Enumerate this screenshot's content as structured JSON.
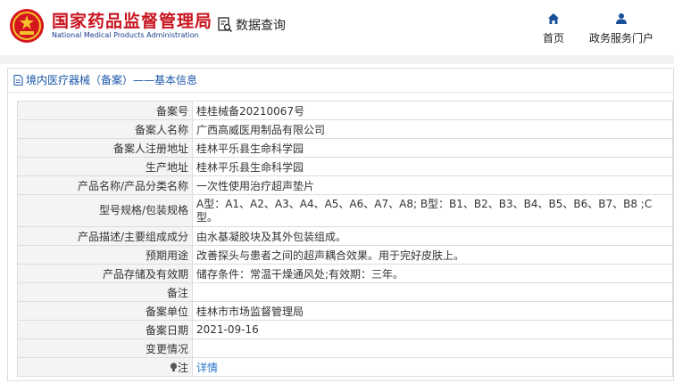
{
  "header": {
    "brand_cn": "国家药品监督管理局",
    "brand_en": "National Medical Products Administration",
    "search_label": "数据查询",
    "nav": [
      {
        "label": "首页",
        "icon": "home-icon"
      },
      {
        "label": "政务服务门户",
        "icon": "user-icon"
      }
    ]
  },
  "panel": {
    "title": "境内医疗器械（备案）——基本信息"
  },
  "rows": [
    {
      "key": "备案号",
      "value": "桂桂械备20210067号"
    },
    {
      "key": "备案人名称",
      "value": "广西高威医用制品有限公司"
    },
    {
      "key": "备案人注册地址",
      "value": "桂林平乐县生命科学园"
    },
    {
      "key": "生产地址",
      "value": "桂林平乐县生命科学园"
    },
    {
      "key": "产品名称/产品分类名称",
      "value": "一次性使用治疗超声垫片"
    },
    {
      "key": "型号规格/包装规格",
      "value": "A型：A1、A2、A3、A4、A5、A6、A7、A8; B型：B1、B2、B3、B4、B5、B6、B7、B8 ;C型。"
    },
    {
      "key": "产品描述/主要组成成分",
      "value": "由水基凝胶块及其外包装组成。"
    },
    {
      "key": "预期用途",
      "value": "改善探头与患者之间的超声耦合效果。用于完好皮肤上。"
    },
    {
      "key": "产品存储及有效期",
      "value": "储存条件：常温干燥通风处;有效期：三年。"
    },
    {
      "key": "备注",
      "value": ""
    },
    {
      "key": "备案单位",
      "value": "桂林市市场监督管理局"
    },
    {
      "key": "备案日期",
      "value": "2021-09-16"
    },
    {
      "key": "变更情况",
      "value": ""
    }
  ],
  "note": {
    "key": "注",
    "icon": "lightbulb-icon",
    "link": "详情"
  },
  "colors": {
    "brand_red": "#c8141f",
    "link_blue": "#2a73c9",
    "title_blue": "#1a56a8"
  }
}
